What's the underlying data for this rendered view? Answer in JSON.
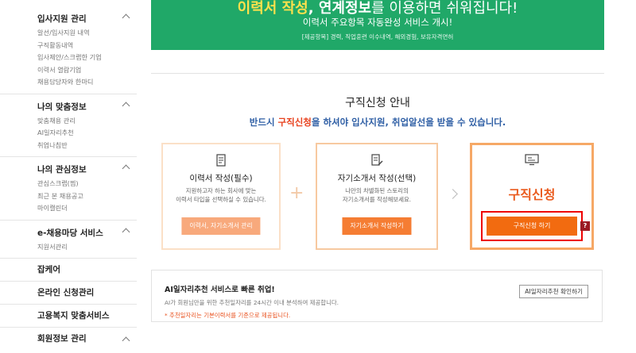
{
  "sidebar": {
    "sections": [
      {
        "title": "입사지원 관리",
        "items": [
          "알선/입사지원 내역",
          "구직활동내역",
          "입사제안/스크랩한 기업",
          "이력서 열람기업",
          "채용담당자와 한마디"
        ]
      },
      {
        "title": "나의 맞춤정보",
        "items": [
          "맞춤채용 관리",
          "AI일자리추천",
          "취업나침반"
        ]
      },
      {
        "title": "나의 관심정보",
        "items": [
          "관심스크랩(찜)",
          "최근 본 채용공고",
          "마이캘린더"
        ]
      },
      {
        "title": "e-채용마당 서비스",
        "items": [
          "지원서관리"
        ]
      }
    ],
    "links": [
      "잡케어",
      "온라인 신청관리",
      "고용복지 맞춤서비스"
    ],
    "last_section": "회원정보 관리"
  },
  "banner": {
    "title_highlight_1": "이력서 작성",
    "title_sep": ", ",
    "title_highlight_2": "연계정보",
    "title_rest": "를 이용하면 쉬워집니다!",
    "subtitle": "이력서 주요항목 자동완성 서비스 개시!",
    "note": "[제공항목] 경력, 직업훈련 이수내역, 해외경험, 보유자격면허"
  },
  "guide": {
    "title": "구직신청 안내",
    "sub_pre": "반드시 ",
    "sub_highlight": "구직신청",
    "sub_post": "을 하셔야 입사지원, 취업알선을 받을 수 있습니다.",
    "cards": [
      {
        "title": "이력서 작성(필수)",
        "desc_1": "지원하고자 하는 회사에 맞는",
        "desc_2": "이력서 타입을 선택하실 수 있습니다.",
        "button": "이력서, 자기소개서 관리"
      },
      {
        "title": "자기소개서 작성(선택)",
        "desc_1": "나만의 차별화된 스토리의",
        "desc_2": "자기소개서를 작성해보세요.",
        "button": "자기소개서 작성하기"
      }
    ],
    "apply": {
      "title": "구직신청",
      "button": "구직신청 하기",
      "help": "?"
    }
  },
  "ai": {
    "title": "AI일자리추천 서비스로 빠른 취업!",
    "desc": "AI가 회원님만을 위한 추천일자리를 24시간 이내 분석하여 제공합니다.",
    "note": "* 추천일자리는 기본이력서를 기준으로 제공됩니다.",
    "button": "AI일자리추천 확인하기"
  },
  "colors": {
    "banner": "#20a868",
    "accent": "#f26b10",
    "highlight_red": "#e8411d",
    "guide_blue": "#2f5fa5"
  }
}
